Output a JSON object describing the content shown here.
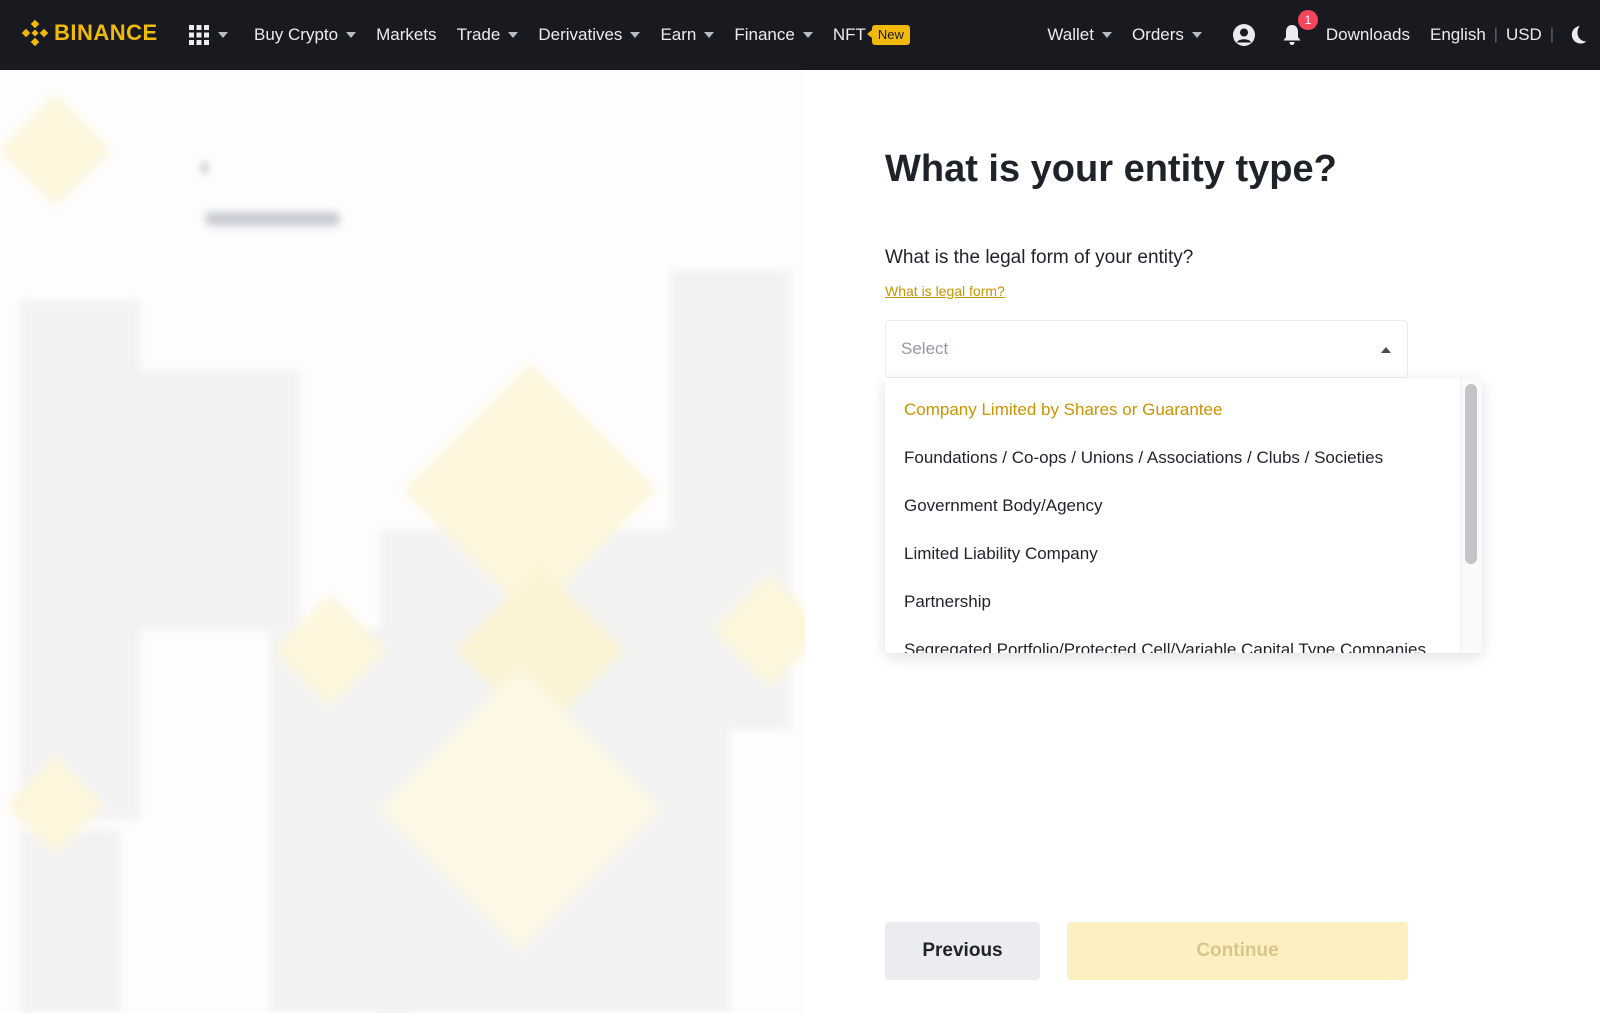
{
  "nav": {
    "brand": "BINANCE",
    "left_items": [
      {
        "label": "Buy Crypto",
        "has_dropdown": true
      },
      {
        "label": "Markets",
        "has_dropdown": false
      },
      {
        "label": "Trade",
        "has_dropdown": true
      },
      {
        "label": "Derivatives",
        "has_dropdown": true
      },
      {
        "label": "Earn",
        "has_dropdown": true
      },
      {
        "label": "Finance",
        "has_dropdown": true
      },
      {
        "label": "NFT",
        "badge": "New"
      }
    ],
    "right_items": {
      "wallet": "Wallet",
      "orders": "Orders",
      "notification_count": "1",
      "downloads": "Downloads",
      "language": "English",
      "separator": "|",
      "currency": "USD"
    },
    "icons": [
      "binance-logo-icon",
      "apps-grid-icon",
      "user-profile-icon",
      "bell-icon",
      "moon-theme-icon"
    ],
    "colors": {
      "background": "#181a20",
      "brand": "#f0b90b",
      "text": "#eaecef",
      "alert": "#f6465d"
    }
  },
  "form": {
    "title": "What is your entity type?",
    "question": "What is the legal form of your entity?",
    "help_link": "What is legal form?",
    "select_placeholder": "Select",
    "options": [
      "Company Limited by Shares or Guarantee",
      "Foundations / Co-ops / Unions / Associations / Clubs / Societies",
      "Government Body/Agency",
      "Limited Liability Company",
      "Partnership",
      "Segregated Portfolio/Protected Cell/Variable Capital Type Companies"
    ],
    "highlighted_option": "Company Limited by Shares or Guarantee",
    "buttons": {
      "previous": "Previous",
      "continue": "Continue"
    },
    "continue_enabled": false,
    "colors": {
      "accent": "#c99400",
      "continue_disabled_bg": "#fcf0c2",
      "previous_bg": "#eaecef"
    }
  }
}
